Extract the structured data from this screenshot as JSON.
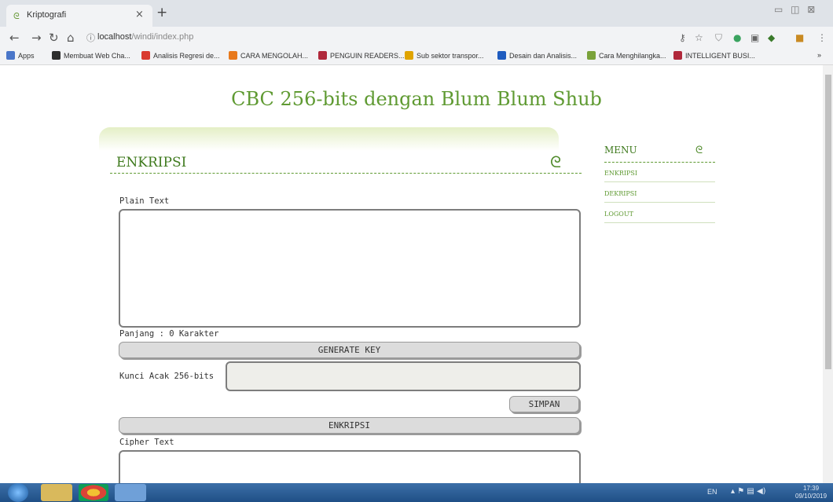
{
  "browser": {
    "tab_title": "Kriptografi",
    "tab_close": "×",
    "new_tab": "+",
    "url_host": "localhost",
    "url_path": "/windi/index.php",
    "window_controls": "▭ ◫ ⊠",
    "bookmarks": [
      {
        "label": "Apps",
        "icon_color": "#4a76c9"
      },
      {
        "label": "Membuat Web Cha...",
        "icon_color": "#2d2d2d"
      },
      {
        "label": "Analisis Regresi de...",
        "icon_color": "#d93a2f"
      },
      {
        "label": "CARA MENGOLAH...",
        "icon_color": "#e8791c"
      },
      {
        "label": "PENGUIN READERS...",
        "icon_color": "#b0283b"
      },
      {
        "label": "Sub sektor transpor...",
        "icon_color": "#e0a400"
      },
      {
        "label": "Desain dan Analisis...",
        "icon_color": "#1e5bbf"
      },
      {
        "label": "Cara Menghilangka...",
        "icon_color": "#7aa23a"
      },
      {
        "label": "INTELLIGENT BUSI...",
        "icon_color": "#b0283b"
      }
    ],
    "bookmarks_more": "»"
  },
  "page": {
    "title": "CBC 256-bits dengan Blum Blum Shub",
    "section_title": "ENKRIPSI",
    "ornament": "ᘓ"
  },
  "form": {
    "plain_label": "Plain Text",
    "plain_value": "",
    "length_label": "Panjang : 0 Karakter",
    "generate_button": "GENERATE KEY",
    "key_label": "Kunci Acak 256-bits",
    "key_value": "",
    "save_button": "SIMPAN",
    "encrypt_button": "ENKRIPSI",
    "cipher_label": "Cipher Text",
    "cipher_value": ""
  },
  "menu": {
    "title": "MENU",
    "items": [
      "ENKRIPSI",
      "DEKRIPSI",
      "LOGOUT"
    ]
  },
  "taskbar": {
    "lang": "EN",
    "time": "17:39",
    "date": "09/10/2019"
  },
  "colors": {
    "accent_green": "#5f9a32",
    "dark_green": "#3f7a1e",
    "button_gray": "#dcdcdc"
  }
}
